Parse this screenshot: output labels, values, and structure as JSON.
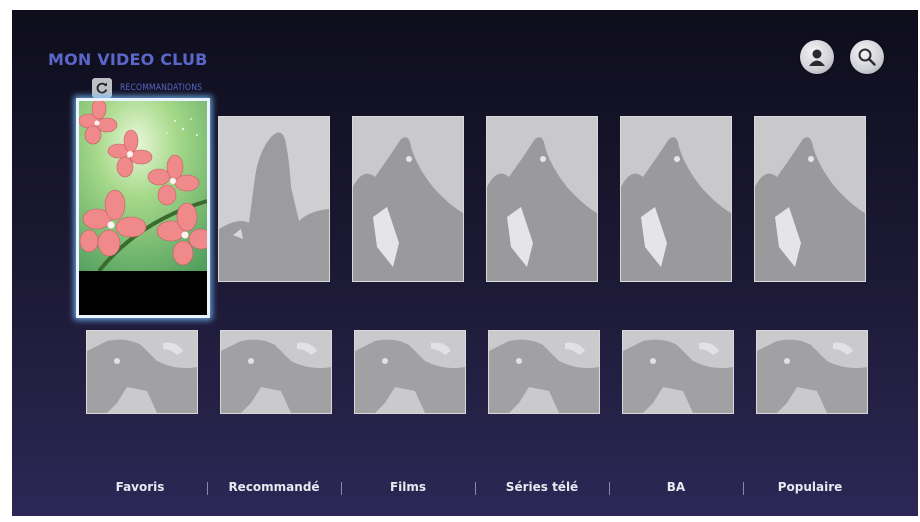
{
  "app": {
    "title": "MON VIDEO CLUB",
    "section_label": "RECOMMANDATIONS",
    "section_icon": "refresh-icon"
  },
  "header_icons": [
    {
      "name": "profile-icon",
      "label": ""
    },
    {
      "name": "search-icon",
      "label": ""
    }
  ],
  "grid": {
    "row1_count": 6,
    "row2_count": 6,
    "selected_index": 0,
    "selected_art": "pink-orchid-flowers",
    "placeholder_top": "silhouette-figure",
    "placeholder_bottom": "abstract-shape"
  },
  "nav": {
    "items": [
      "Favoris",
      "Recommandé",
      "Films",
      "Séries télé",
      "BA",
      "Populaire"
    ]
  },
  "colors": {
    "title": "#5a66c8",
    "background_top": "#0e0d1c",
    "background_bottom": "#2c2756",
    "selection_glow": "#78beff",
    "placeholder": "#c7c7c9"
  }
}
